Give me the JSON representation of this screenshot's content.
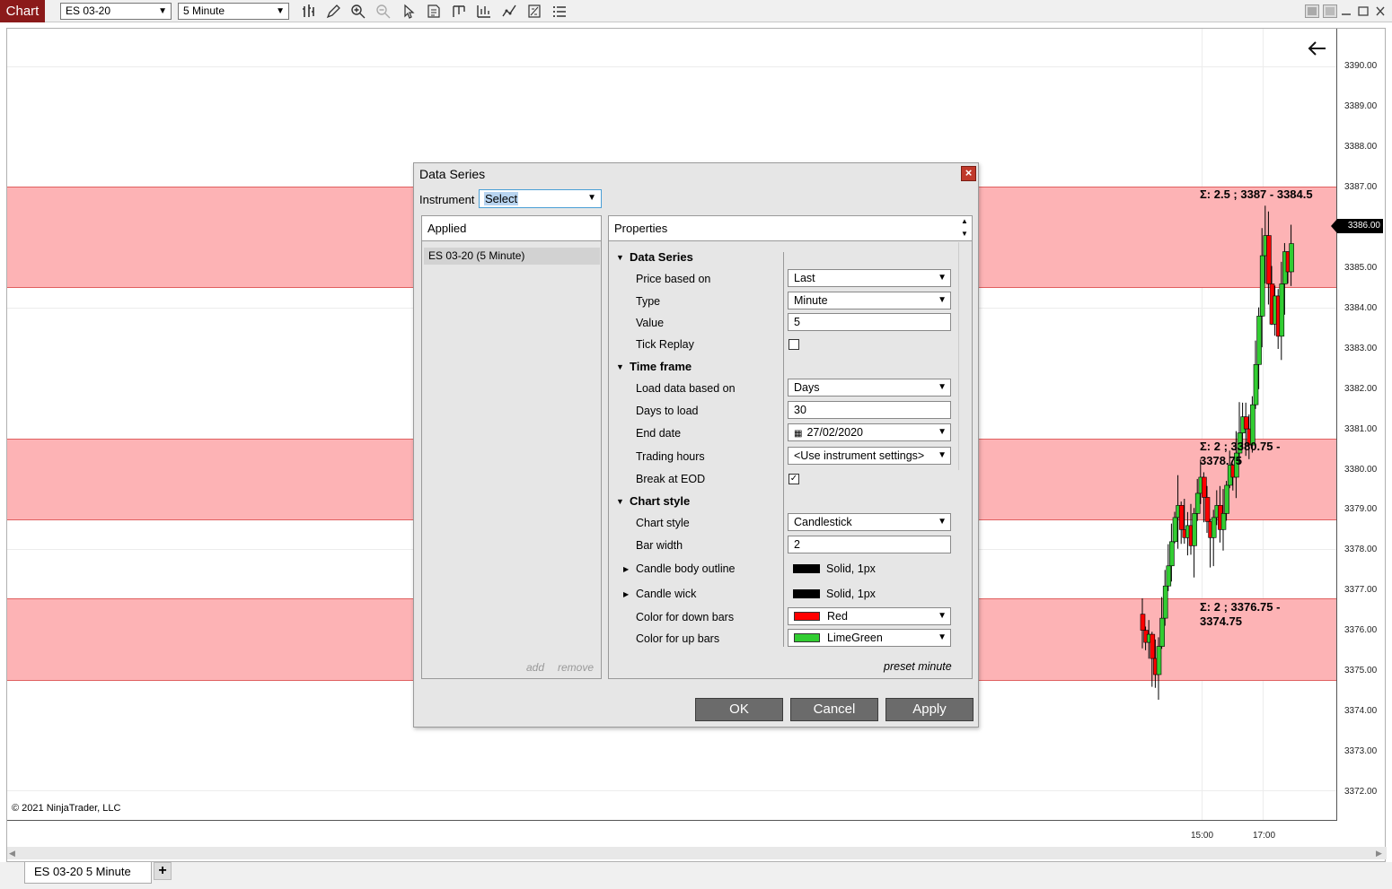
{
  "toolbar": {
    "app_tab": "Chart",
    "instrument": "ES 03-20",
    "interval": "5 Minute",
    "icons": [
      "bars-type-icon",
      "drawing-tool-icon",
      "zoom-in-icon",
      "zoom-out-icon",
      "pointer-icon",
      "data-series-icon",
      "strategy-icon",
      "indicators-icon",
      "templates-icon",
      "properties-icon",
      "list-icon"
    ],
    "window_buttons": [
      "tile-icon",
      "tile2-icon",
      "minimize-icon",
      "maximize-icon",
      "close-icon"
    ]
  },
  "chart": {
    "copyright": "© 2021 NinjaTrader, LLC",
    "current_price": "3386.00",
    "y_ticks": [
      "3390.00",
      "3389.00",
      "3388.00",
      "3387.00",
      "3385.00",
      "3384.00",
      "3383.00",
      "3382.00",
      "3381.00",
      "3380.00",
      "3379.00",
      "3378.00",
      "3377.00",
      "3376.00",
      "3375.00",
      "3374.00",
      "3373.00",
      "3372.00"
    ],
    "x_ticks": [
      "15:00",
      "17:00"
    ],
    "zones": [
      {
        "label_line1": "Σ: 2.5   ; 3387 - 3384.5",
        "label_line2": ""
      },
      {
        "label_line1": "Σ: 2    ; 3380.75 -",
        "label_line2": "3378.75"
      },
      {
        "label_line1": "Σ: 2    ; 3376.75 -",
        "label_line2": "3374.75"
      }
    ],
    "zone_color": "#fdb3b5",
    "up_color": "#32cd32",
    "down_color": "#ff0000"
  },
  "bottom_tabs": {
    "active": "ES 03-20 5 Minute",
    "add": "+"
  },
  "dialog": {
    "title": "Data Series",
    "close": "×",
    "instrument_label": "Instrument",
    "instrument_value": "Select",
    "applied_header": "Applied",
    "applied_items": [
      "ES 03-20 (5 Minute)"
    ],
    "add": "add",
    "remove": "remove",
    "properties_header": "Properties",
    "sections": {
      "data_series": "Data Series",
      "time_frame": "Time frame",
      "chart_style": "Chart style"
    },
    "props": {
      "price_based_on": {
        "label": "Price based on",
        "value": "Last"
      },
      "type": {
        "label": "Type",
        "value": "Minute"
      },
      "value": {
        "label": "Value",
        "value": "5"
      },
      "tick_replay": {
        "label": "Tick Replay",
        "checked": false
      },
      "load_data_based_on": {
        "label": "Load data based on",
        "value": "Days"
      },
      "days_to_load": {
        "label": "Days to load",
        "value": "30"
      },
      "end_date": {
        "label": "End date",
        "value": "27/02/2020"
      },
      "trading_hours": {
        "label": "Trading hours",
        "value": "<Use instrument settings>"
      },
      "break_at_eod": {
        "label": "Break at EOD",
        "checked": true
      },
      "chart_style": {
        "label": "Chart style",
        "value": "Candlestick"
      },
      "bar_width": {
        "label": "Bar width",
        "value": "2"
      },
      "candle_body_outline": {
        "label": "Candle body outline",
        "value": "Solid, 1px"
      },
      "candle_wick": {
        "label": "Candle wick",
        "value": "Solid, 1px"
      },
      "color_down": {
        "label": "Color for down bars",
        "value": "Red",
        "swatch": "#ff0000"
      },
      "color_up": {
        "label": "Color for up bars",
        "value": "LimeGreen",
        "swatch": "#32cd32"
      }
    },
    "preset": "preset minute",
    "buttons": {
      "ok": "OK",
      "cancel": "Cancel",
      "apply": "Apply"
    }
  }
}
